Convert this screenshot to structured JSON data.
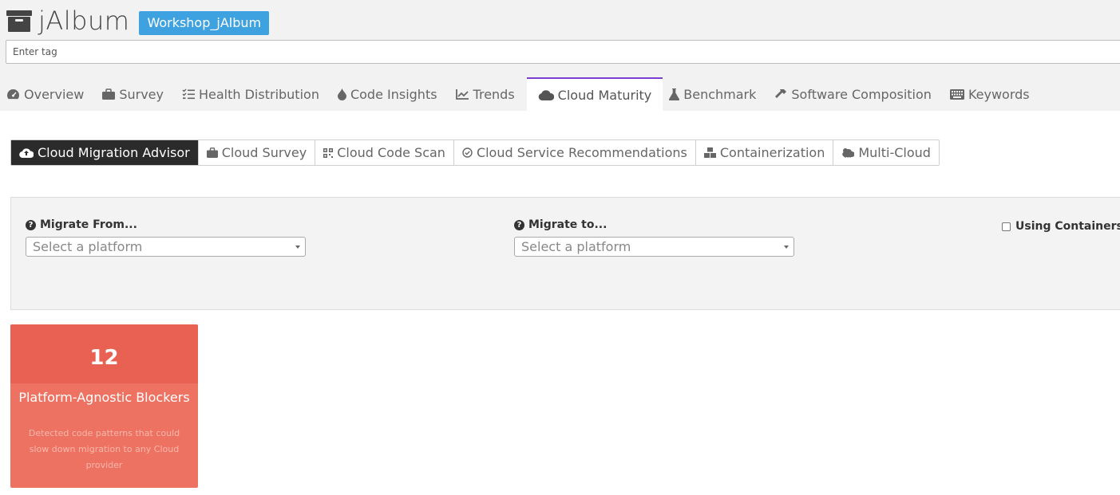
{
  "header": {
    "app_title": "jAlbum",
    "project_badge": "Workshop_jAlbum",
    "tag_placeholder": "Enter tag"
  },
  "main_tabs": [
    {
      "label": "Overview",
      "icon": "dashboard-icon"
    },
    {
      "label": "Survey",
      "icon": "briefcase-icon"
    },
    {
      "label": "Health Distribution",
      "icon": "list-check-icon"
    },
    {
      "label": "Code Insights",
      "icon": "drop-icon"
    },
    {
      "label": "Trends",
      "icon": "line-chart-icon"
    },
    {
      "label": "Cloud Maturity",
      "icon": "cloud-icon",
      "active": true
    },
    {
      "label": "Benchmark",
      "icon": "flask-icon"
    },
    {
      "label": "Software Composition",
      "icon": "hammer-icon"
    },
    {
      "label": "Keywords",
      "icon": "keyboard-icon"
    }
  ],
  "sub_tabs": [
    {
      "label": "Cloud Migration Advisor",
      "icon": "cloud-upload-icon",
      "active": true
    },
    {
      "label": "Cloud Survey",
      "icon": "briefcase-icon"
    },
    {
      "label": "Cloud Code Scan",
      "icon": "qrcode-icon"
    },
    {
      "label": "Cloud Service Recommendations",
      "icon": "check-circle-icon"
    },
    {
      "label": "Containerization",
      "icon": "boxes-icon"
    },
    {
      "label": "Multi-Cloud",
      "icon": "cloud-sun-icon"
    }
  ],
  "filters": {
    "migrate_from_label": "Migrate From...",
    "migrate_from_placeholder": "Select a platform",
    "migrate_to_label": "Migrate to...",
    "migrate_to_placeholder": "Select a platform",
    "containers_label": "Using Containers"
  },
  "card": {
    "count": "12",
    "title": "Platform-Agnostic Blockers",
    "description": "Detected code patterns that could slow down migration to any Cloud provider"
  },
  "colors": {
    "badge": "#3fa2e0",
    "active_tab_border": "#7a3fd0",
    "active_subtab": "#2b2b2b",
    "card": "#ee7262",
    "card_top": "#e96152"
  }
}
